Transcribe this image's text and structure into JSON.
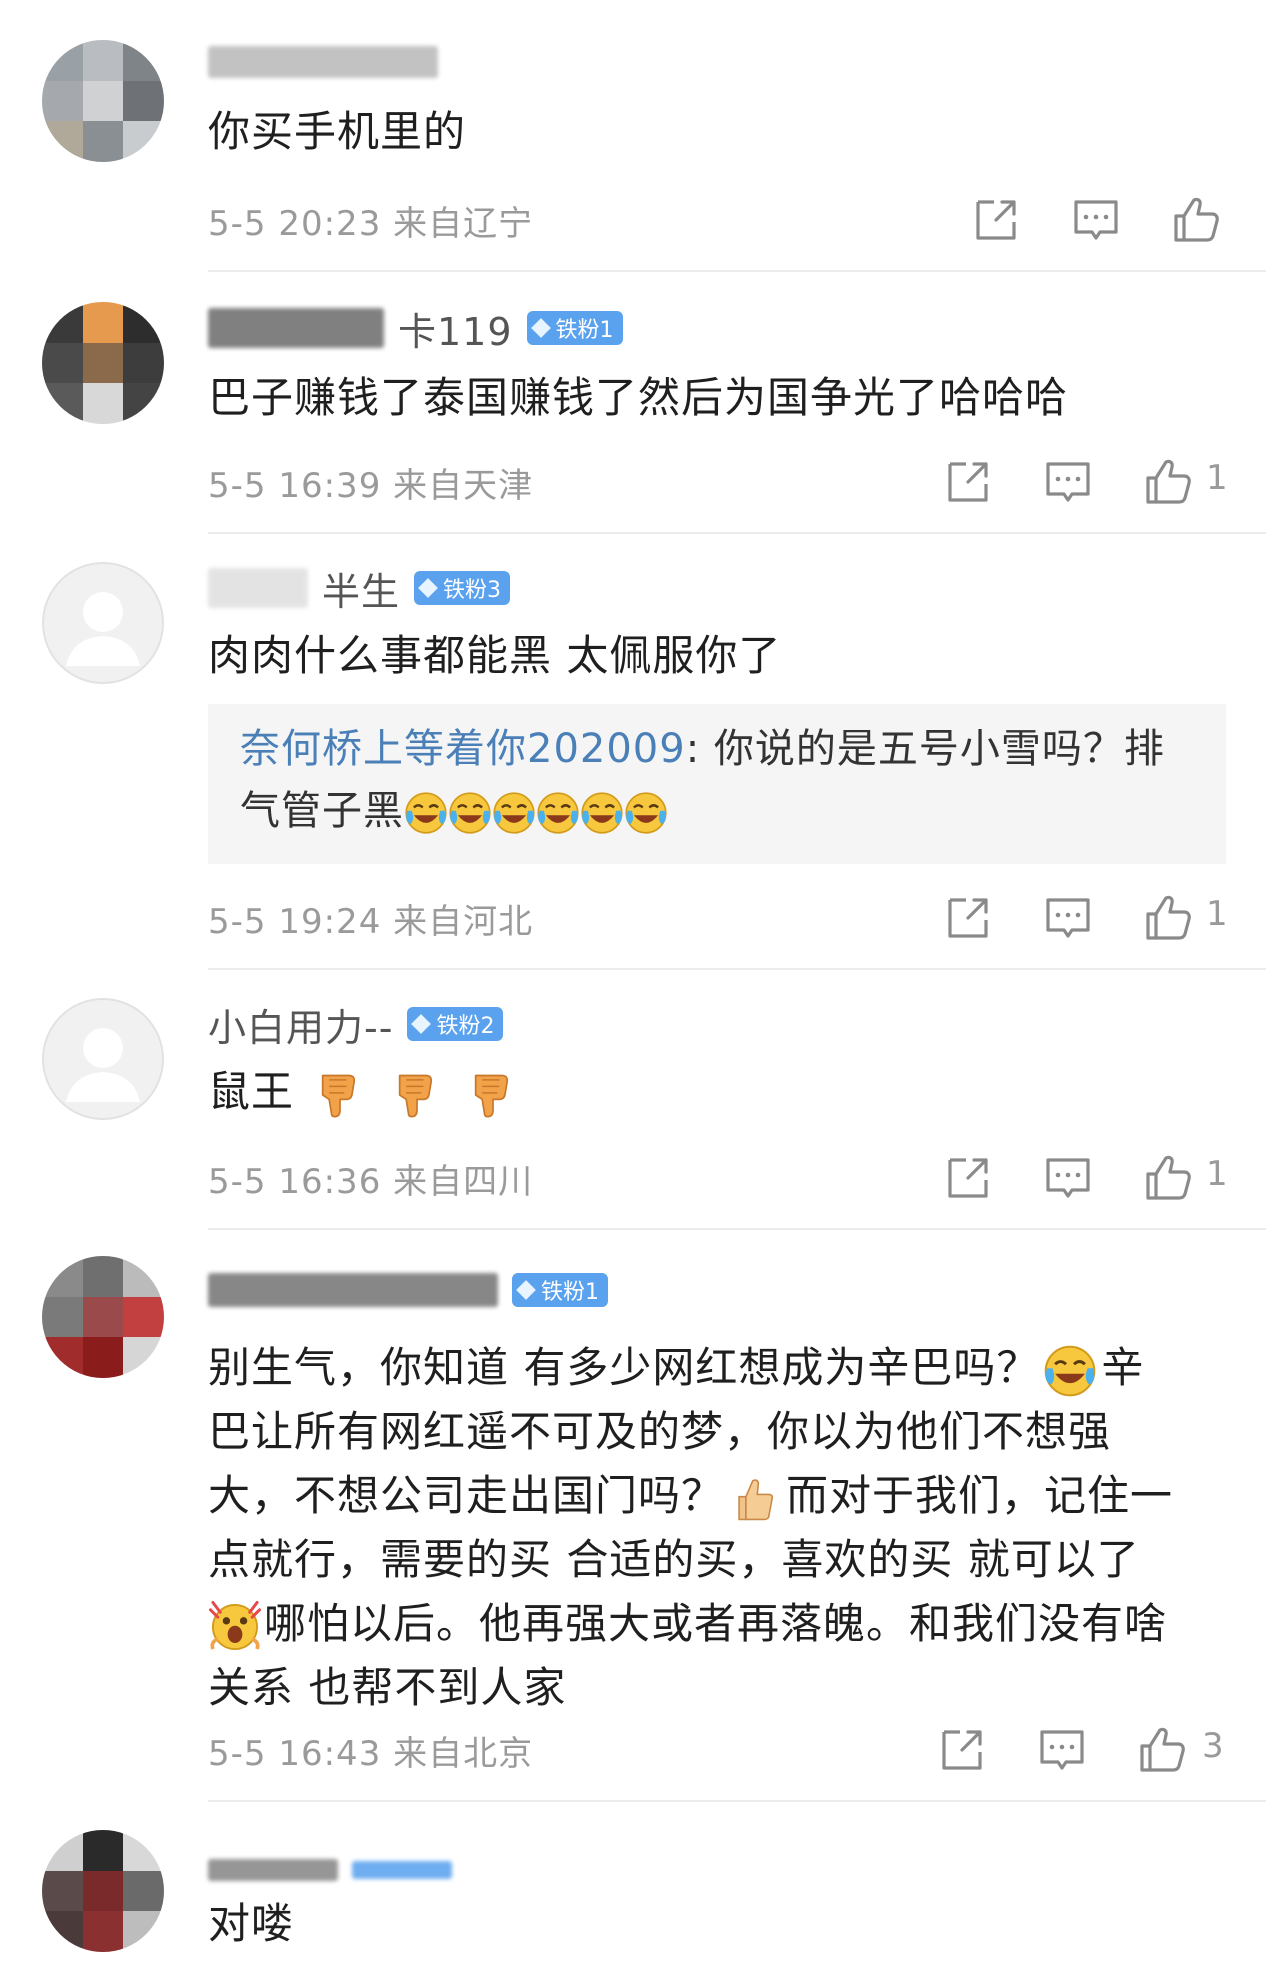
{
  "comments": [
    {
      "name_visible": "",
      "text": "你买手机里的",
      "time": "5-5 20:23",
      "location": "来自辽宁",
      "likes": ""
    },
    {
      "name_visible": "卡119",
      "badge": "铁粉1",
      "text": "巴子赚钱了泰国赚钱了然后为国争光了哈哈哈",
      "time": "5-5 16:39",
      "location": "来自天津",
      "likes": "1"
    },
    {
      "name_visible": "半生",
      "badge": "铁粉3",
      "text": "肉肉什么事都能黑 太佩服你了",
      "quote": {
        "name": "奈何桥上等着你202009",
        "text": ": 你说的是五号小雪吗？排气管子黑",
        "emoji": "laugh-cry"
      },
      "time": "5-5 19:24",
      "location": "来自河北",
      "likes": "1"
    },
    {
      "name_visible": "小白用力--",
      "badge": "铁粉2",
      "text": "鼠王",
      "emoji": "thumbs-down",
      "time": "5-5 16:36",
      "location": "来自四川",
      "likes": "1"
    },
    {
      "name_visible": "",
      "badge": "铁粉1",
      "text_parts": {
        "line1": "别生气，你知道 有多少网红想成为辛巴吗？",
        "line1b": "辛",
        "line2": "巴让所有网红遥不可及的梦，你以为他们不想强",
        "line3": "大，不想公司走出国门吗？",
        "line3b": "而对于我们，记住一",
        "line4": "点就行，需要的买 合适的买，喜欢的买 就可以了",
        "line5": "哪怕以后。他再强大或者再落魄。和我们没有啥",
        "line6": "关系 也帮不到人家"
      },
      "time": "5-5 16:43",
      "location": "来自北京",
      "likes": "3"
    },
    {
      "name_visible": "",
      "badge": "",
      "text": "对喽"
    }
  ],
  "icons": [
    "share-icon",
    "comment-icon",
    "like-icon"
  ],
  "colors": {
    "badge": "#5aa2ee",
    "quote_name": "#4a7fb8",
    "meta": "#9a9a9a"
  }
}
